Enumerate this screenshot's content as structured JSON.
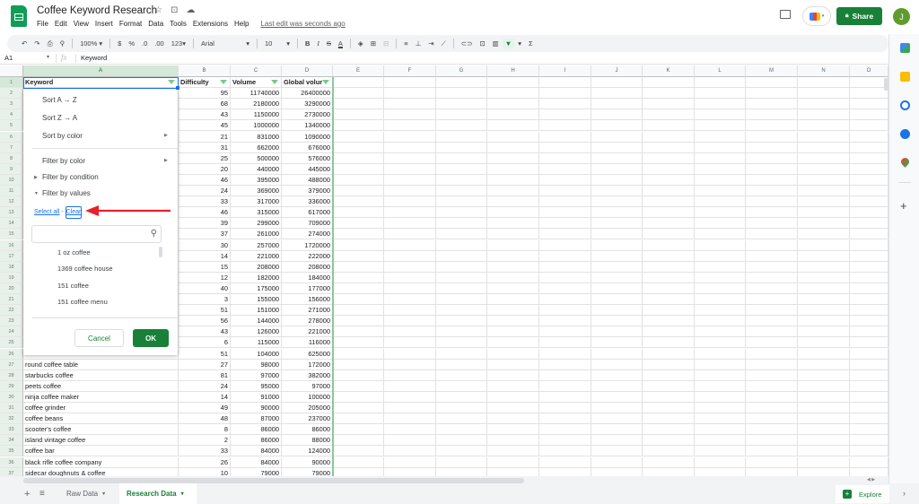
{
  "app": {
    "title": "Coffee Keyword Research",
    "menu": [
      "File",
      "Edit",
      "View",
      "Insert",
      "Format",
      "Data",
      "Tools",
      "Extensions",
      "Help"
    ],
    "last_edit": "Last edit was seconds ago",
    "share_label": "Share",
    "avatar_initial": "J",
    "icons": {
      "star": "☆",
      "folder": "⊡",
      "cloud": "☁"
    }
  },
  "toolbar": {
    "undo": "↶",
    "redo": "↷",
    "print": "⎙",
    "paint": "⚲",
    "zoom": "100%",
    "currency": "$",
    "percent": "%",
    "dec_less": ".0",
    "dec_more": ".00",
    "format": "123",
    "font": "Arial",
    "size": "10",
    "bold": "B",
    "italic": "I",
    "strike": "S",
    "text_color": "A",
    "fill": "◈",
    "borders": "⊞",
    "merge": "⊟",
    "align": "≡",
    "valign": "⊥",
    "wrap": "⇥",
    "rotate": "⟋",
    "link": "⊂⊃",
    "comment": "⊡",
    "chart": "▥",
    "filter": "▼",
    "functions": "Σ",
    "caret": "▾"
  },
  "formula_bar": {
    "cell_ref": "A1",
    "fx": "fx",
    "value": "Keyword"
  },
  "columns": [
    "A",
    "B",
    "C",
    "D",
    "E",
    "F",
    "G",
    "H",
    "I",
    "J",
    "K",
    "L",
    "M",
    "N",
    "O"
  ],
  "header_row": [
    "Keyword",
    "Difficulty",
    "Volume",
    "Global volur"
  ],
  "rows": [
    {
      "n": 2,
      "kw": "",
      "d": "95",
      "v": "11740000",
      "g": "26400000"
    },
    {
      "n": 3,
      "kw": "",
      "d": "68",
      "v": "2180000",
      "g": "3290000"
    },
    {
      "n": 4,
      "kw": "",
      "d": "43",
      "v": "1150000",
      "g": "2730000"
    },
    {
      "n": 5,
      "kw": "",
      "d": "45",
      "v": "1000000",
      "g": "1340000"
    },
    {
      "n": 6,
      "kw": "",
      "d": "21",
      "v": "831000",
      "g": "1090000"
    },
    {
      "n": 7,
      "kw": "",
      "d": "31",
      "v": "662000",
      "g": "676000"
    },
    {
      "n": 8,
      "kw": "",
      "d": "25",
      "v": "500000",
      "g": "576000"
    },
    {
      "n": 9,
      "kw": "",
      "d": "20",
      "v": "440000",
      "g": "445000"
    },
    {
      "n": 10,
      "kw": "",
      "d": "46",
      "v": "395000",
      "g": "488000"
    },
    {
      "n": 11,
      "kw": "",
      "d": "24",
      "v": "369000",
      "g": "379000"
    },
    {
      "n": 12,
      "kw": "",
      "d": "33",
      "v": "317000",
      "g": "336000"
    },
    {
      "n": 13,
      "kw": "",
      "d": "46",
      "v": "315000",
      "g": "617000"
    },
    {
      "n": 14,
      "kw": "",
      "d": "39",
      "v": "299000",
      "g": "709000"
    },
    {
      "n": 15,
      "kw": "",
      "d": "37",
      "v": "261000",
      "g": "274000"
    },
    {
      "n": 16,
      "kw": "",
      "d": "30",
      "v": "257000",
      "g": "1720000"
    },
    {
      "n": 17,
      "kw": "",
      "d": "14",
      "v": "221000",
      "g": "222000"
    },
    {
      "n": 18,
      "kw": "",
      "d": "15",
      "v": "208000",
      "g": "208000"
    },
    {
      "n": 19,
      "kw": "",
      "d": "12",
      "v": "182000",
      "g": "184000"
    },
    {
      "n": 20,
      "kw": "",
      "d": "40",
      "v": "175000",
      "g": "177000"
    },
    {
      "n": 21,
      "kw": "",
      "d": "3",
      "v": "155000",
      "g": "156000"
    },
    {
      "n": 22,
      "kw": "",
      "d": "51",
      "v": "151000",
      "g": "271000"
    },
    {
      "n": 23,
      "kw": "",
      "d": "56",
      "v": "144000",
      "g": "278000"
    },
    {
      "n": 24,
      "kw": "",
      "d": "43",
      "v": "126000",
      "g": "221000"
    },
    {
      "n": 25,
      "kw": "",
      "d": "6",
      "v": "115000",
      "g": "116000"
    },
    {
      "n": 26,
      "kw": "",
      "d": "51",
      "v": "104000",
      "g": "625000"
    },
    {
      "n": 27,
      "kw": "round coffee table",
      "d": "27",
      "v": "98000",
      "g": "172000"
    },
    {
      "n": 28,
      "kw": "starbucks coffee",
      "d": "81",
      "v": "97000",
      "g": "382000"
    },
    {
      "n": 29,
      "kw": "peets coffee",
      "d": "24",
      "v": "95000",
      "g": "97000"
    },
    {
      "n": 30,
      "kw": "ninja coffee maker",
      "d": "14",
      "v": "91000",
      "g": "100000"
    },
    {
      "n": 31,
      "kw": "coffee grinder",
      "d": "49",
      "v": "90000",
      "g": "205000"
    },
    {
      "n": 32,
      "kw": "coffee beans",
      "d": "48",
      "v": "87000",
      "g": "237000"
    },
    {
      "n": 33,
      "kw": "scooter's coffee",
      "d": "8",
      "v": "86000",
      "g": "86000"
    },
    {
      "n": 34,
      "kw": "island vintage coffee",
      "d": "2",
      "v": "86000",
      "g": "88000"
    },
    {
      "n": 35,
      "kw": "coffee bar",
      "d": "33",
      "v": "84000",
      "g": "124000"
    },
    {
      "n": 36,
      "kw": "black rifle coffee company",
      "d": "26",
      "v": "84000",
      "g": "90000"
    },
    {
      "n": 37,
      "kw": "sidecar doughnuts & coffee",
      "d": "10",
      "v": "79000",
      "g": "79000"
    }
  ],
  "filter_menu": {
    "sort_az": "Sort A → Z",
    "sort_za": "Sort Z → A",
    "sort_color": "Sort by color",
    "filter_color": "Filter by color",
    "filter_condition": "Filter by condition",
    "filter_values": "Filter by values",
    "select_all": "Select all",
    "dash": " - ",
    "clear": "Clear",
    "search_placeholder": "",
    "values": [
      "1 oz coffee",
      "1369 coffee house",
      "151 coffee",
      "151 coffee menu"
    ],
    "cancel": "Cancel",
    "ok": "OK"
  },
  "sheets": {
    "raw": "Raw Data",
    "active": "Research Data",
    "explore": "Explore"
  },
  "colors": {
    "brand_green": "#188038",
    "accent_blue": "#1a73e8",
    "annotation_red": "#e8202a"
  }
}
